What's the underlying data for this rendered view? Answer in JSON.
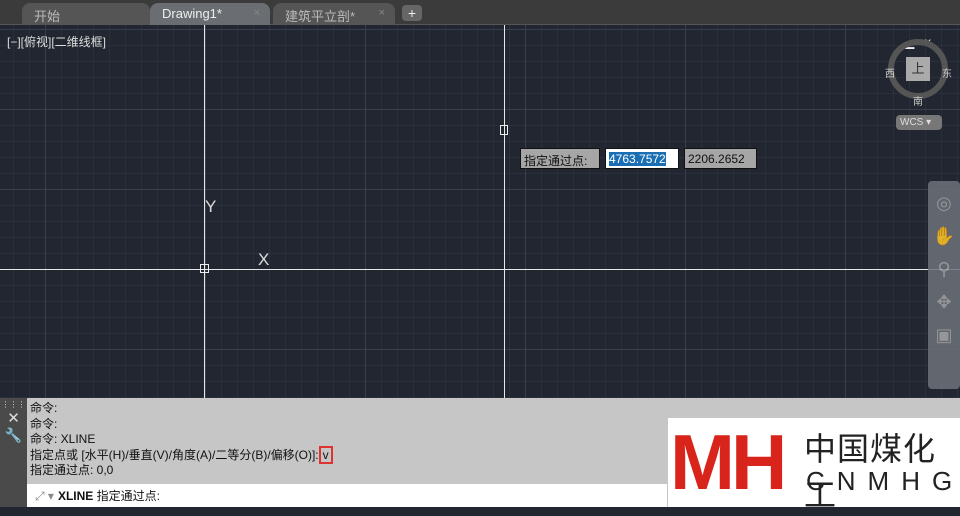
{
  "tabs": [
    {
      "label": "开始"
    },
    {
      "label": "Drawing1*",
      "close": "×"
    },
    {
      "label": "建筑平立剖*",
      "close": "×"
    }
  ],
  "add_tab": "+",
  "viewport_label": "[−][俯视][二维线框]",
  "axis": {
    "x": "X",
    "y": "Y"
  },
  "tooltip": {
    "label": "指定通过点:",
    "x_value": "4763.7572",
    "y_value": "2206.2652"
  },
  "viewcube": {
    "top": "上",
    "west": "西",
    "east": "东",
    "south": "南",
    "wcs": "WCS ▾"
  },
  "window_controls": "▁▫×",
  "command": {
    "history": [
      "命令:",
      "命令:",
      "命令:  XLINE",
      "指定点或 [水平(H)/垂直(V)/角度(A)/二等分(B)/偏移(O)]:",
      "指定通过点: 0,0"
    ],
    "typed": "v",
    "prompt_cmd": "XLINE",
    "prompt_text": "指定通过点:"
  },
  "watermark": {
    "logo": "MH",
    "cn": "中国煤化工",
    "en": "CNMHG"
  }
}
